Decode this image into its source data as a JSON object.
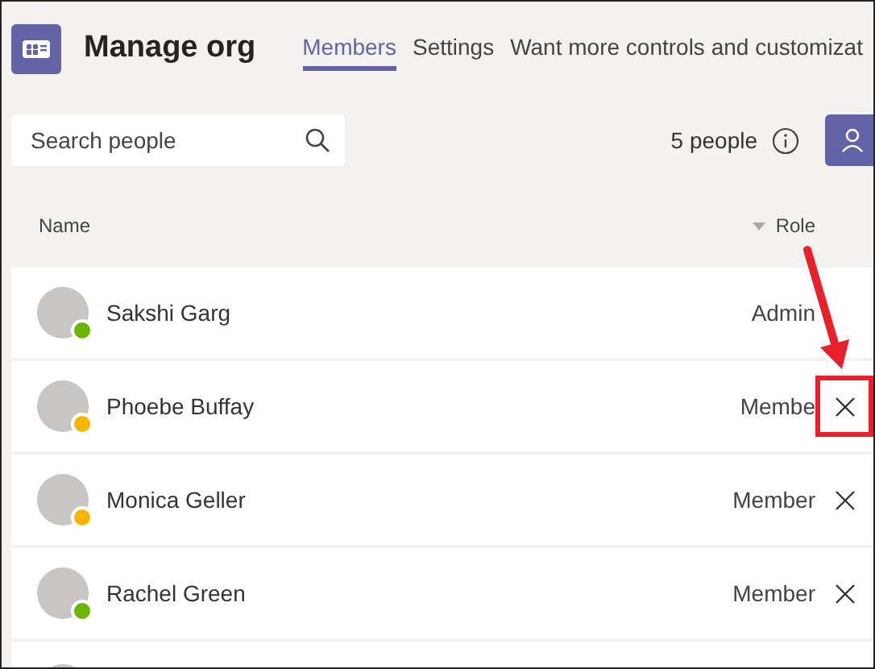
{
  "header": {
    "title": "Manage org",
    "tabs": [
      {
        "label": "Members",
        "selected": true
      },
      {
        "label": "Settings",
        "selected": false
      },
      {
        "label": "Want more controls and customizat",
        "selected": false
      }
    ]
  },
  "toolbar": {
    "search": {
      "placeholder": "Search people"
    },
    "count": "5 people"
  },
  "table": {
    "columns": [
      "Name",
      "Role"
    ],
    "rows": [
      {
        "kind": "member",
        "name": "Sakshi Garg",
        "role": "Admin",
        "color": "#6bb700",
        "removable": false
      },
      {
        "kind": "member",
        "name": "Phoebe Buffay",
        "role": "Membe",
        "color": "#f8b500",
        "removable": true,
        "highlighted": true
      },
      {
        "kind": "member",
        "name": "Monica Geller",
        "role": "Member",
        "color": "#f8b500",
        "removable": true,
        "highlighted": false
      },
      {
        "kind": "member",
        "name": "Rachel Green",
        "role": "Member",
        "color": "#6bb700",
        "removable": true,
        "highlighted": false
      },
      {
        "kind": "cut-off"
      }
    ]
  }
}
